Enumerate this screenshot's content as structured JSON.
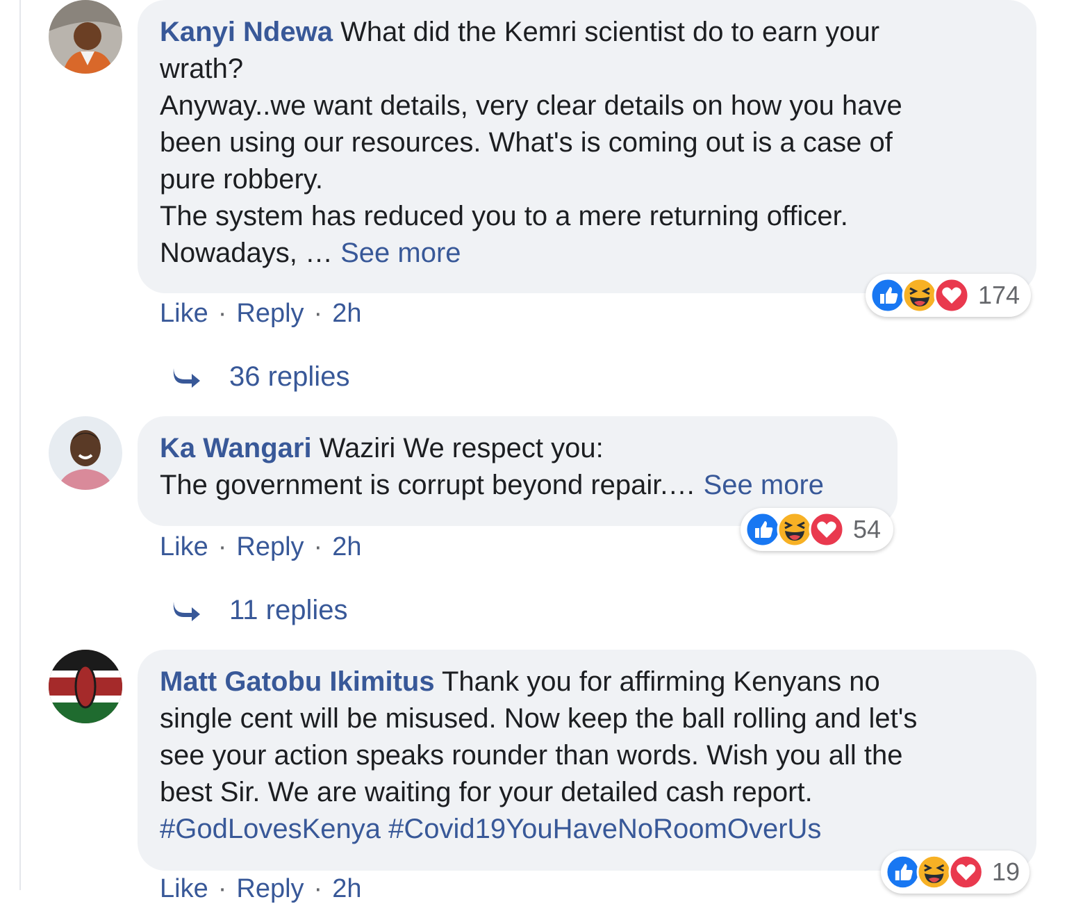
{
  "comments": [
    {
      "author": "Kanyi Ndewa",
      "lines": [
        "What did the Kemri scientist do to earn your",
        "wrath?",
        "Anyway..we want details, very clear details on how you have",
        "been using our resources. What's is coming out is a case of",
        "pure robbery.",
        "The system has reduced you to a mere returning officer.",
        "Nowadays, … "
      ],
      "see_more": "See more",
      "reaction_count": "174",
      "like": "Like",
      "reply": "Reply",
      "time": "2h",
      "replies": "36 replies"
    },
    {
      "author": "Ka Wangari",
      "lines": [
        "Waziri We respect you:",
        "The government is corrupt beyond repair.… "
      ],
      "see_more": "See more",
      "reaction_count": "54",
      "like": "Like",
      "reply": "Reply",
      "time": "2h",
      "replies": "11 replies"
    },
    {
      "author": "Matt Gatobu Ikimitus",
      "lines": [
        "Thank you for affirming Kenyans no",
        "single cent will be misused. Now keep the ball rolling and let's",
        "see your action speaks rounder than words. Wish you all the",
        "best Sir. We are waiting for your detailed cash report."
      ],
      "hashtags": [
        "#GodLovesKenya",
        "#Covid19YouHaveNoRoomOverUs"
      ],
      "reaction_count": "19",
      "like": "Like",
      "reply": "Reply",
      "time": "2h"
    }
  ],
  "icons": {
    "like": "like-reaction-icon",
    "haha": "haha-reaction-icon",
    "love": "love-reaction-icon",
    "reply_arrow": "reply-arrow-icon"
  },
  "colors": {
    "link": "#385898",
    "bubble": "#f0f2f5",
    "like": "#1877f2",
    "haha": "#f7b125",
    "love": "#e9394e"
  }
}
